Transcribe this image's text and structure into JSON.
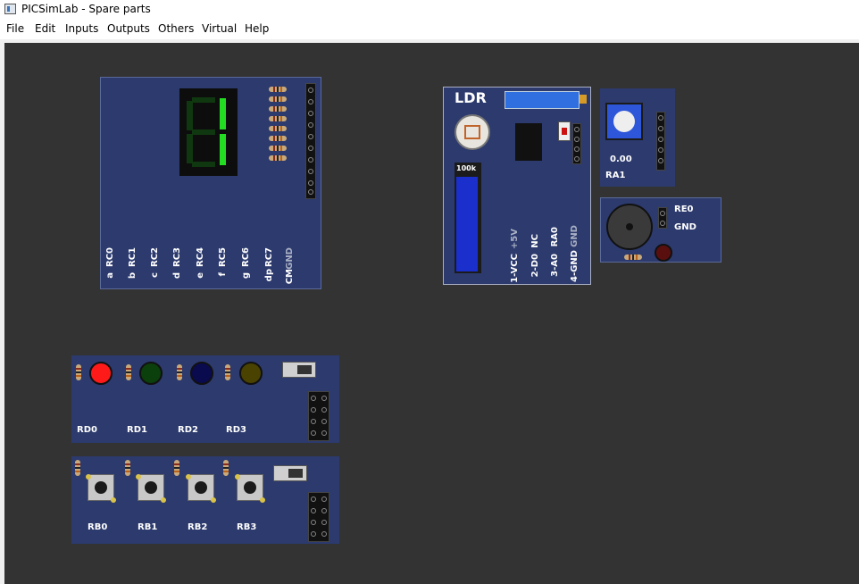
{
  "window": {
    "title": "PICSimLab - Spare parts"
  },
  "menu": {
    "items": [
      {
        "label": "File"
      },
      {
        "label": "Edit"
      },
      {
        "label": "Inputs"
      },
      {
        "label": "Outputs"
      },
      {
        "label": "Others"
      },
      {
        "label": "Virtual"
      },
      {
        "label": "Help"
      }
    ]
  },
  "seven_seg": {
    "segments": [
      "a",
      "b",
      "c",
      "d",
      "e",
      "f",
      "g",
      "dp",
      "CM"
    ],
    "pins": [
      "RC0",
      "RC1",
      "RC2",
      "RC3",
      "RC4",
      "RC5",
      "RC6",
      "RC7",
      "GND"
    ],
    "lit_color": "#22dd22",
    "lit": [
      "b",
      "c"
    ]
  },
  "ldr": {
    "title": "LDR",
    "pot_label": "100k",
    "pin_labels": [
      "1-VCC",
      "2-D0",
      "3-A0",
      "4-GND"
    ],
    "pin_signals": [
      "+5V",
      "NC",
      "RA0",
      "GND"
    ]
  },
  "pot": {
    "value": "0.00",
    "label": "RA1"
  },
  "buzzer": {
    "pin1": "RE0",
    "pin2": "GND"
  },
  "leds": {
    "items": [
      {
        "label": "RD0",
        "color": "#ff1a1a"
      },
      {
        "label": "RD1",
        "color": "#0b3f0b"
      },
      {
        "label": "RD2",
        "color": "#0a0a4f"
      },
      {
        "label": "RD3",
        "color": "#4a4200"
      }
    ]
  },
  "buttons": {
    "items": [
      {
        "label": "RB0"
      },
      {
        "label": "RB1"
      },
      {
        "label": "RB2"
      },
      {
        "label": "RB3"
      }
    ]
  }
}
